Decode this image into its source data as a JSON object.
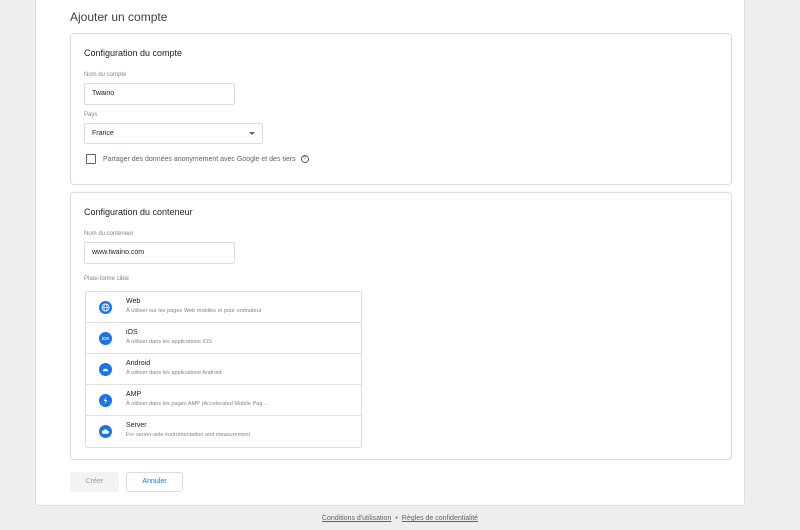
{
  "page": {
    "title": "Ajouter un compte"
  },
  "account": {
    "section_title": "Configuration du compte",
    "name_label": "Nom du compte",
    "name_value": "Twaino",
    "country_label": "Pays",
    "country_value": "France",
    "share_label": "Partager des données anonymement avec Google et des tiers",
    "share_checked": false,
    "help_icon": "help-circle-icon"
  },
  "container": {
    "section_title": "Configuration du conteneur",
    "name_label": "Nom du conteneur",
    "name_value": "www.twaino.com",
    "platform_label": "Plate-forme cible",
    "platforms": [
      {
        "name": "Web",
        "desc": "À utiliser sur les pages Web mobiles et pour ordinateur",
        "icon": "globe-icon"
      },
      {
        "name": "iOS",
        "desc": "À utiliser dans les applications iOS",
        "icon": "ios-icon"
      },
      {
        "name": "Android",
        "desc": "À utiliser dans les applications Android",
        "icon": "android-icon"
      },
      {
        "name": "AMP",
        "desc": "À utiliser dans les pages AMP (Accelerated Mobile Pag...",
        "icon": "amp-bolt-icon"
      },
      {
        "name": "Server",
        "desc": "For server-side instrumentation and measurement",
        "icon": "cloud-icon"
      }
    ]
  },
  "actions": {
    "create_label": "Créer",
    "cancel_label": "Annuler"
  },
  "footer": {
    "terms": "Conditions d'utilisation",
    "separator": "•",
    "privacy": "Règles de confidentialité"
  },
  "colors": {
    "accent": "#1a73e8",
    "border": "#dadce0",
    "background": "#eeeeee"
  }
}
